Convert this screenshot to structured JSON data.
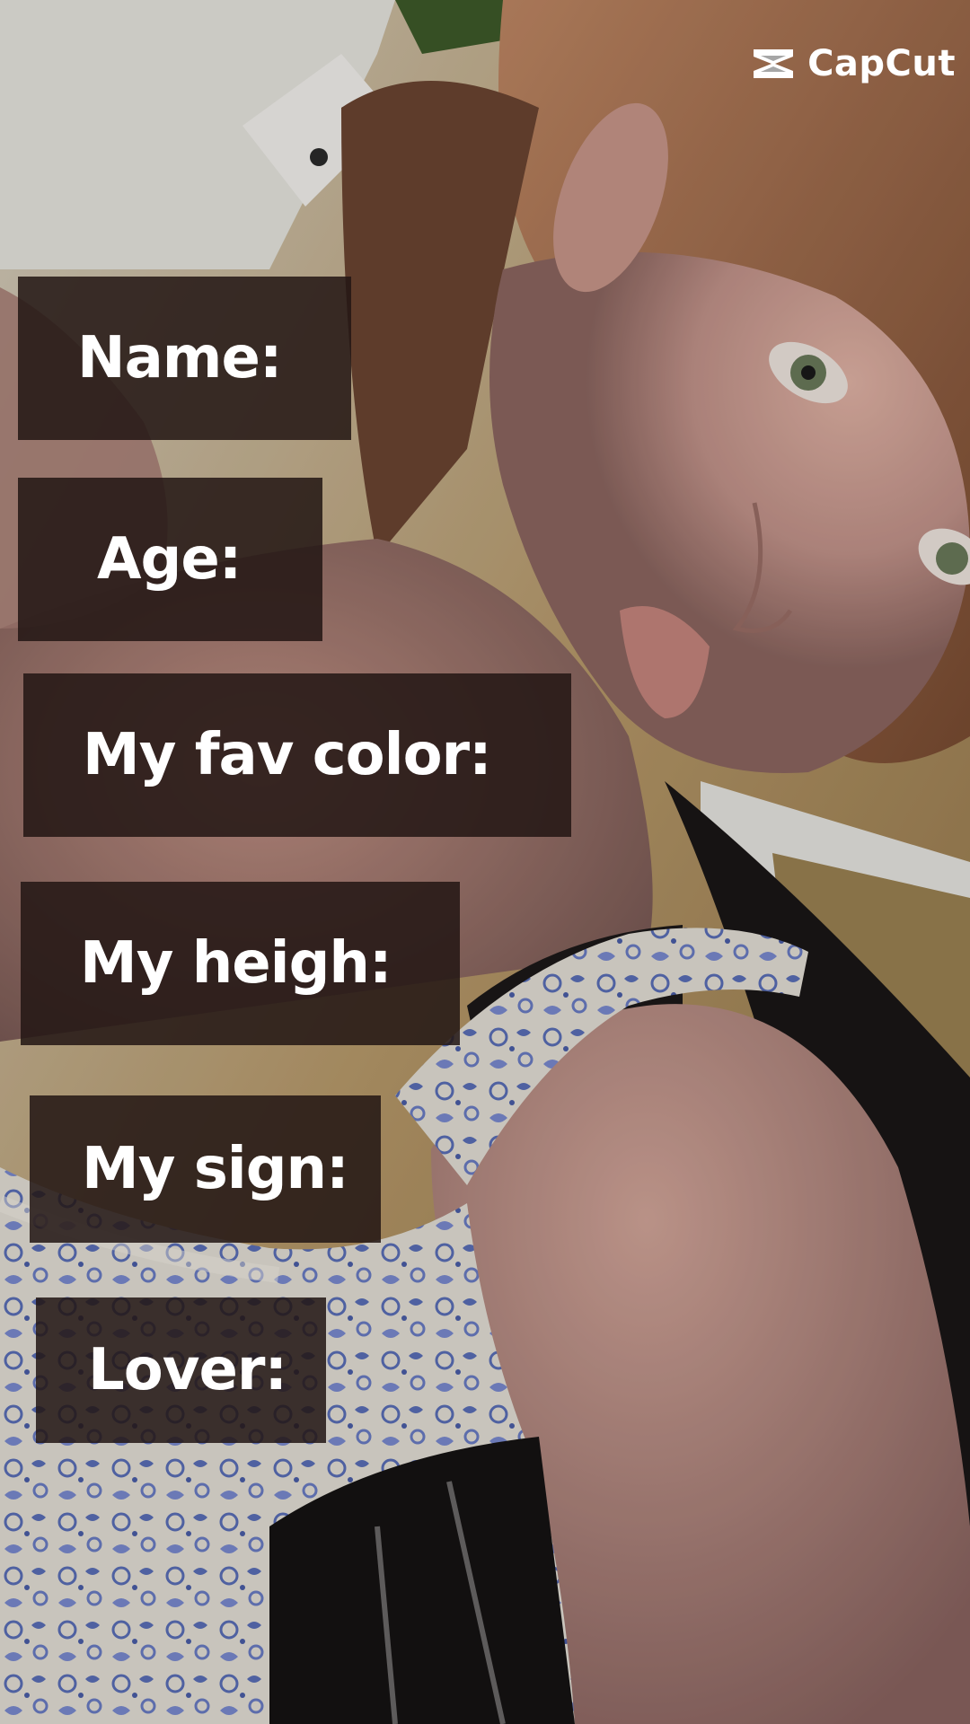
{
  "watermark": {
    "text": "CapCut",
    "icon": "capcut-logo-icon"
  },
  "labels": [
    {
      "id": "name",
      "text": "Name:"
    },
    {
      "id": "age",
      "text": "Age:"
    },
    {
      "id": "color",
      "text": "My fav color:"
    },
    {
      "id": "height",
      "text": "My heigh:"
    },
    {
      "id": "sign",
      "text": "My sign:"
    },
    {
      "id": "lover",
      "text": "Lover:"
    }
  ],
  "colors": {
    "label_background": "#231614",
    "label_text": "#ffffff",
    "wall": "#b89a6a",
    "skin": "#c99b8c",
    "dress_base": "#e8e4dc",
    "dress_print": "#5a6fb8"
  }
}
